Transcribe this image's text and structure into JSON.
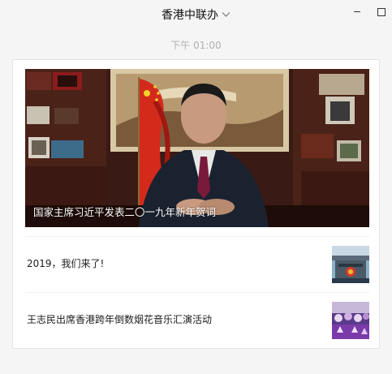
{
  "window": {
    "title": "香港中联办",
    "chevron": "chevron-down-icon",
    "minimize_icon": "minimize-icon",
    "maximize_icon": "maximize-icon"
  },
  "message": {
    "timestamp": "下午 01:00"
  },
  "card": {
    "cover": {
      "caption": "国家主席习近平发表二〇一九年新年贺词"
    },
    "articles": [
      {
        "title": "2019，我们来了!"
      },
      {
        "title": "王志民出席香港跨年倒数烟花音乐汇演活动"
      }
    ]
  }
}
